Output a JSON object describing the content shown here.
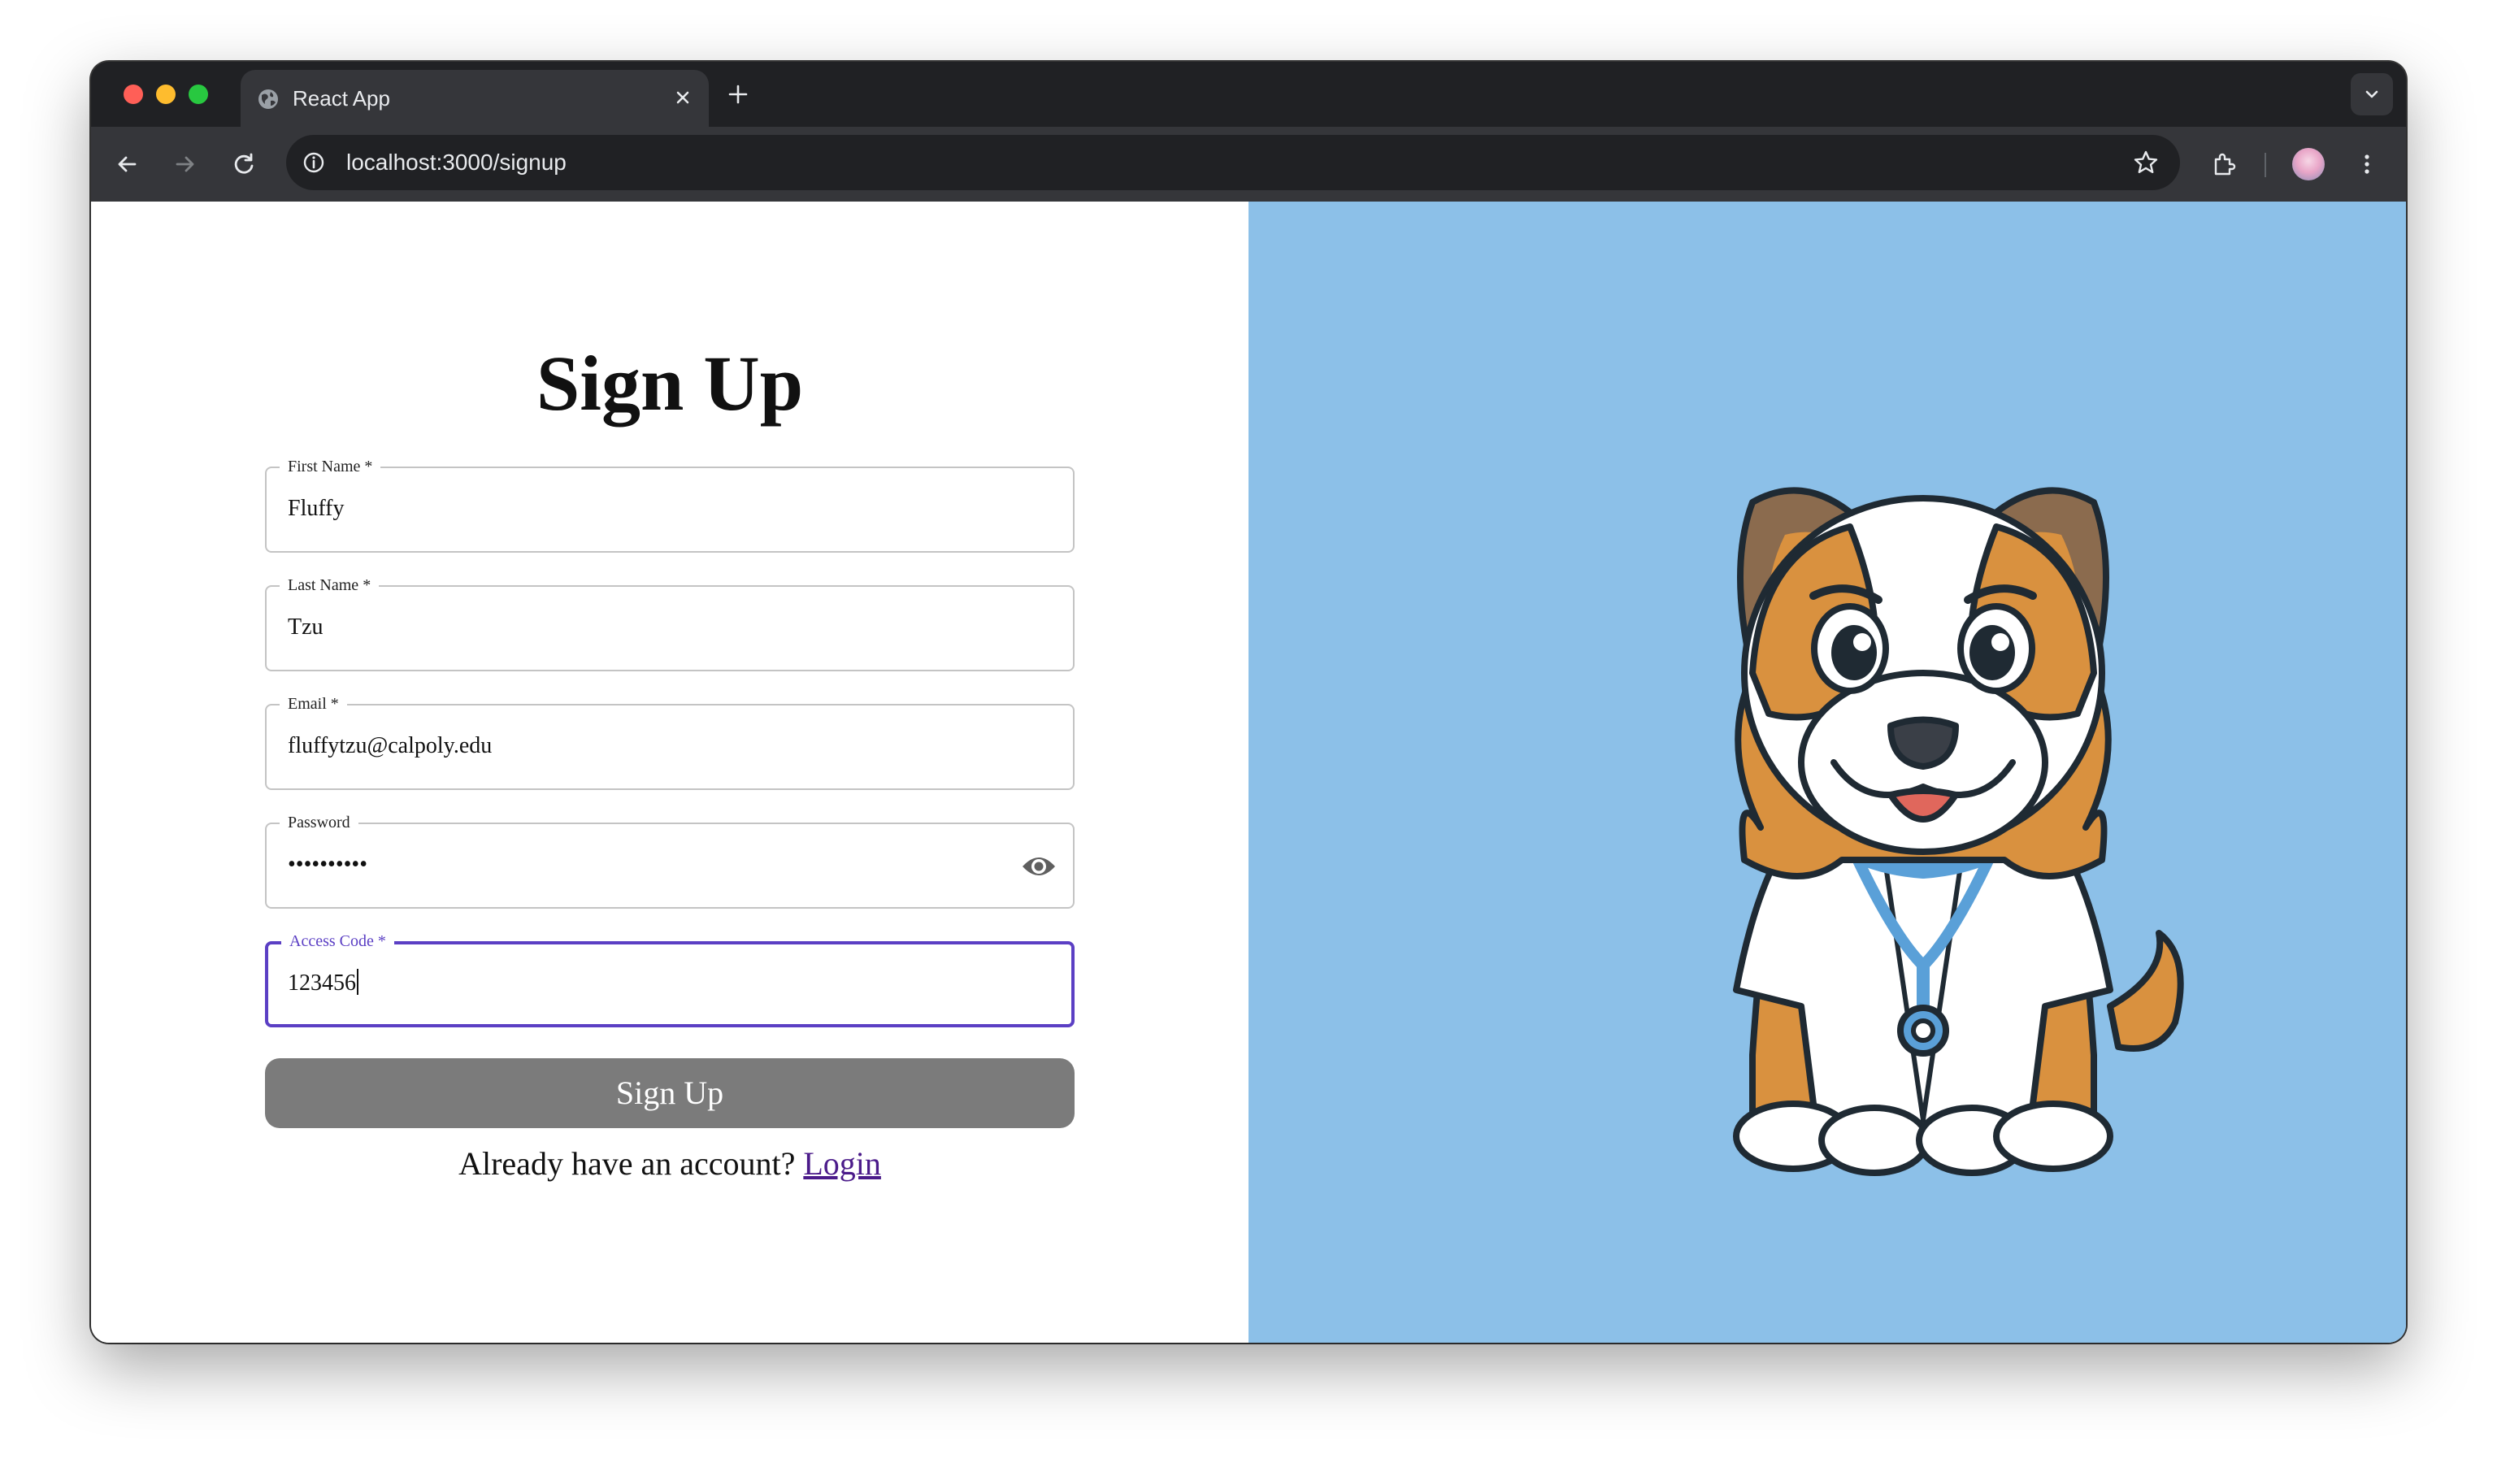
{
  "browser": {
    "tab_title": "React App",
    "url": "localhost:3000/signup"
  },
  "page": {
    "title": "Sign Up",
    "fields": {
      "first_name": {
        "label": "First Name *",
        "value": "Fluffy"
      },
      "last_name": {
        "label": "Last Name *",
        "value": "Tzu"
      },
      "email": {
        "label": "Email *",
        "value": "fluffytzu@calpoly.edu"
      },
      "password": {
        "label": "Password",
        "value": "••••••••••"
      },
      "access_code": {
        "label": "Access Code *",
        "value": "123456"
      }
    },
    "submit_label": "Sign Up",
    "login_prompt": "Already have an account?",
    "login_link": "Login"
  },
  "colors": {
    "accent": "#5b3fc4",
    "button": "#7b7b7b",
    "illustration_bg": "#8cc0e8",
    "link": "#4b1b8a"
  },
  "icons": {
    "tab_favicon": "globe-icon",
    "password_toggle": "eye-icon",
    "illustration": "dog-doctor-illustration"
  }
}
